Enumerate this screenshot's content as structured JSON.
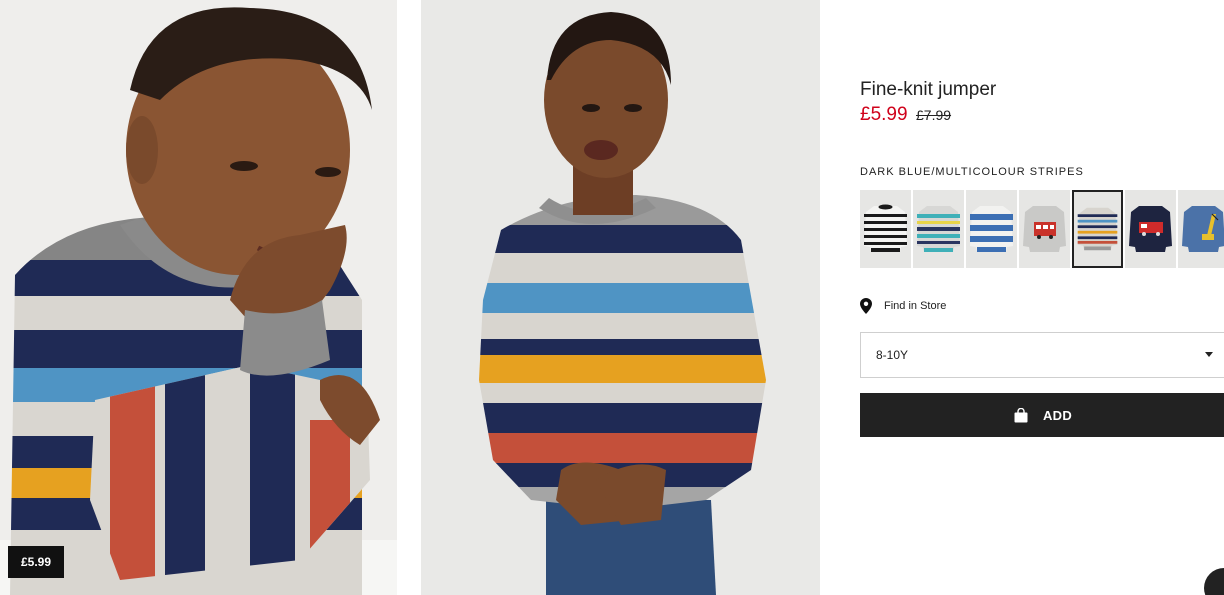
{
  "product": {
    "title": "Fine-knit jumper",
    "price_current": "£5.99",
    "price_original": "£7.99",
    "color_name": "DARK BLUE/MULTICOLOUR STRIPES",
    "selected_size": "8-10Y",
    "badge_price": "£5.99"
  },
  "actions": {
    "find_in_store": "Find in Store",
    "add_label": "ADD"
  },
  "colors": {
    "price_sale": "#d0021b",
    "button_bg": "#222222"
  },
  "icons": {
    "store": "map-pin-icon",
    "bag": "shopping-bag-icon",
    "dropdown": "chevron-down-icon"
  },
  "swatches": [
    {
      "name": "black/white stripes"
    },
    {
      "name": "turquoise stripes"
    },
    {
      "name": "blue/white stripes"
    },
    {
      "name": "grey with bus print"
    },
    {
      "name": "dark blue/multicolour stripes",
      "selected": true
    },
    {
      "name": "dark blue with fire engine"
    },
    {
      "name": "blue with crane print"
    }
  ]
}
